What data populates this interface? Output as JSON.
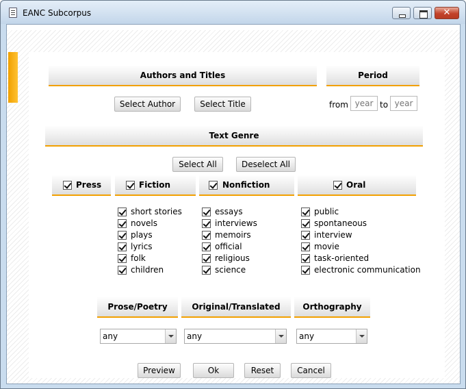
{
  "window": {
    "title": "EANC Subcorpus"
  },
  "authors_titles": {
    "header": "Authors and Titles",
    "select_author": "Select Author",
    "select_title": "Select Title"
  },
  "period": {
    "header": "Period",
    "from_label": "from",
    "to_label": "to",
    "from_placeholder": "year",
    "to_placeholder": "year"
  },
  "text_genre": {
    "header": "Text Genre",
    "select_all": "Select All",
    "deselect_all": "Deselect All",
    "categories": [
      {
        "label": "Press",
        "checked": true,
        "items": []
      },
      {
        "label": "Fiction",
        "checked": true,
        "items": [
          {
            "label": "short stories",
            "checked": true
          },
          {
            "label": "novels",
            "checked": true
          },
          {
            "label": "plays",
            "checked": true
          },
          {
            "label": "lyrics",
            "checked": true
          },
          {
            "label": "folk",
            "checked": true
          },
          {
            "label": "children",
            "checked": true
          }
        ]
      },
      {
        "label": "Nonfiction",
        "checked": true,
        "items": [
          {
            "label": "essays",
            "checked": true
          },
          {
            "label": "interviews",
            "checked": true
          },
          {
            "label": "memoirs",
            "checked": true
          },
          {
            "label": "official",
            "checked": true
          },
          {
            "label": "religious",
            "checked": true
          },
          {
            "label": "science",
            "checked": true
          }
        ]
      },
      {
        "label": "Oral",
        "checked": true,
        "items": [
          {
            "label": "public",
            "checked": true
          },
          {
            "label": "spontaneous",
            "checked": true
          },
          {
            "label": "interview",
            "checked": true
          },
          {
            "label": "movie",
            "checked": true
          },
          {
            "label": "task-oriented",
            "checked": true
          },
          {
            "label": "electronic communication",
            "checked": true
          }
        ]
      }
    ]
  },
  "filters": {
    "prose_poetry": {
      "header": "Prose/Poetry",
      "value": "any"
    },
    "original_translated": {
      "header": "Original/Translated",
      "value": "any"
    },
    "orthography": {
      "header": "Orthography",
      "value": "any"
    }
  },
  "actions": {
    "preview": "Preview",
    "ok": "Ok",
    "reset": "Reset",
    "cancel": "Cancel"
  },
  "colors": {
    "accent": "#f2a000",
    "titlebar": "#c3d6ea"
  }
}
